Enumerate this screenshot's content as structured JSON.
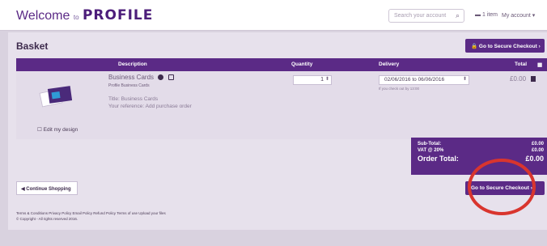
{
  "header": {
    "brand_welcome": "Welcome",
    "brand_to": "to",
    "brand_profile": "PROFILE",
    "search_placeholder": "Search your account",
    "cart_label": "1 item",
    "account_label": "My account"
  },
  "page": {
    "title": "Basket",
    "checkout_top_label": "Go to Secure Checkout",
    "checkout_bottom_label": "Go to Secure Checkout",
    "continue_label": "Continue Shopping"
  },
  "table": {
    "headers": {
      "description": "Description",
      "quantity": "Quantity",
      "delivery": "Delivery",
      "total": "Total"
    },
    "item": {
      "name": "Business Cards",
      "sub": "Profile Business Cards",
      "title_line": "Title: Business Cards",
      "reference_line": "Your reference: Add purchase order",
      "edit_label": "Edit my design",
      "quantity": "1",
      "delivery": "02/06/2016 to 06/06/2016",
      "delivery_note": "If you check out by 13:00",
      "line_total": "£0.00"
    }
  },
  "summary": {
    "subtotal_label": "Sub-Total:",
    "subtotal_value": "£0.00",
    "vat_label": "VAT @ 20%",
    "vat_value": "£0.00",
    "order_total_label": "Order Total:",
    "order_total_value": "£0.00"
  },
  "footer": {
    "links": "Terms & Conditions  Privacy Policy  Email Policy  Refund Policy  Terms of use  Upload your files",
    "copyright": "© Copyright - All rights reserved 2016."
  },
  "colors": {
    "brand_purple": "#5b2a86",
    "highlight_red": "#d9352e"
  }
}
